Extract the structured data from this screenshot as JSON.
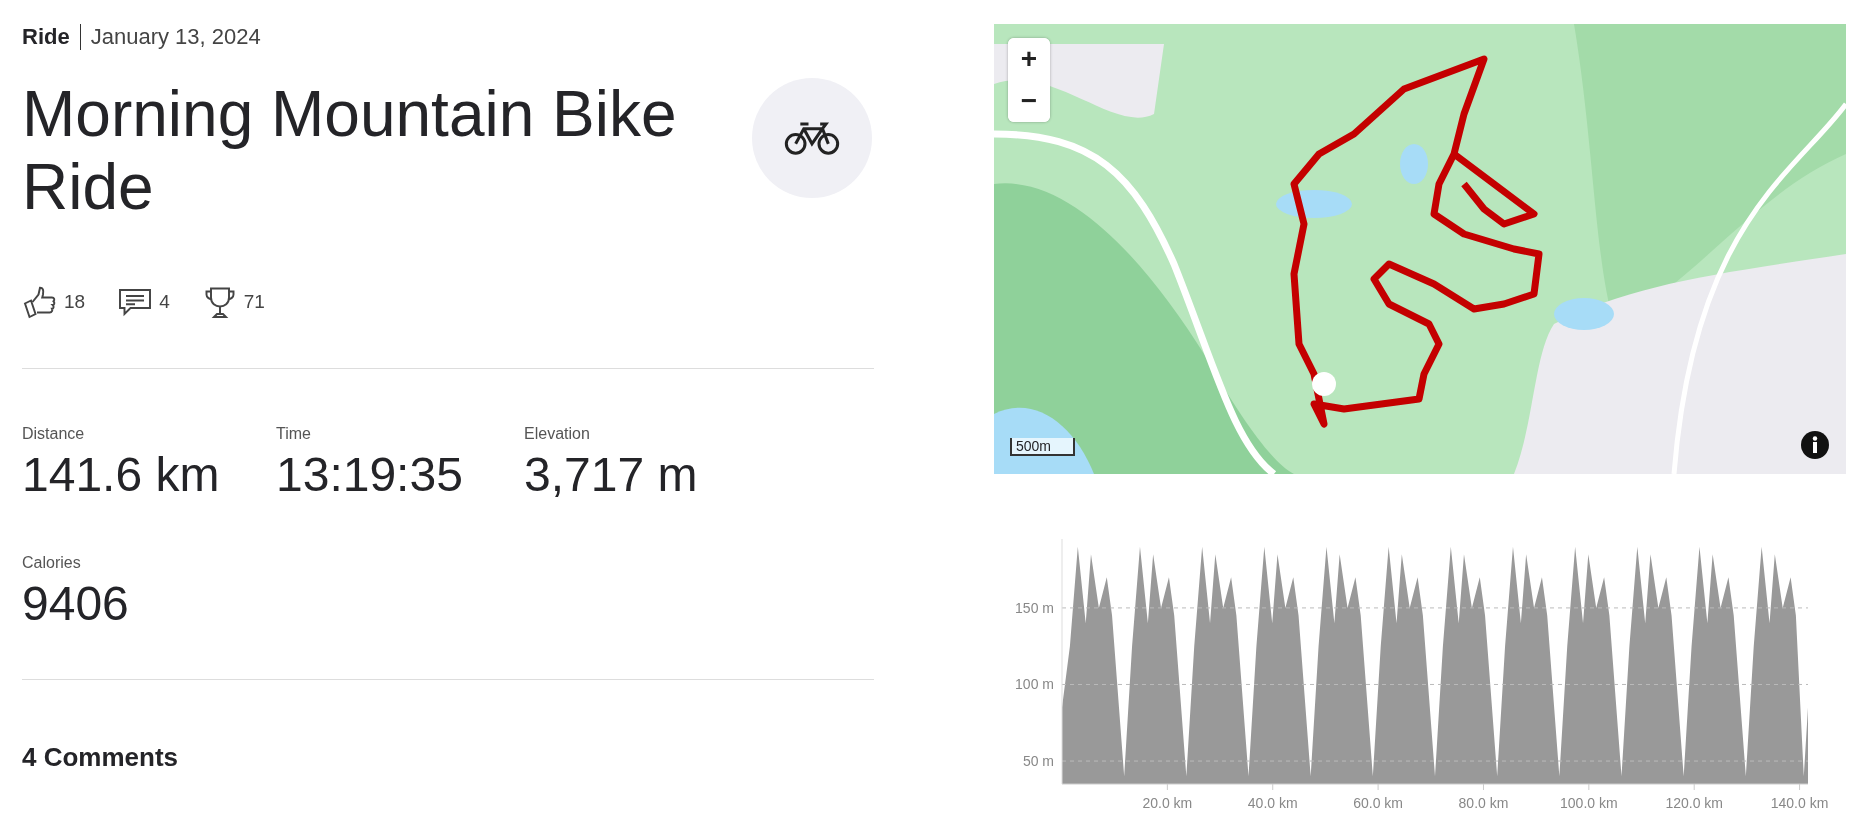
{
  "header": {
    "sport": "Ride",
    "date": "January 13, 2024"
  },
  "title": "Morning Mountain Bike Ride",
  "social": [
    {
      "kind": "kudos",
      "count": "18"
    },
    {
      "kind": "comments",
      "count": "4"
    },
    {
      "kind": "achievements",
      "count": "71"
    }
  ],
  "stats": [
    {
      "label": "Distance",
      "value": "141.6 km"
    },
    {
      "label": "Time",
      "value": "13:19:35"
    },
    {
      "label": "Elevation",
      "value": "3,717 m"
    },
    {
      "label": "Calories",
      "value": "9406"
    }
  ],
  "comments_heading": "4 Comments",
  "map": {
    "kind": "picture",
    "zoom_in": "+",
    "zoom_out": "−",
    "scale": "500m"
  },
  "elevation": {
    "chart_data": {
      "type": "area",
      "xlim": [
        0,
        141.6
      ],
      "ylim": [
        35,
        195
      ],
      "grid": true,
      "xticks": [
        {
          "value": 20,
          "label": "20.0 km"
        },
        {
          "value": 40,
          "label": "40.0 km"
        },
        {
          "value": 60,
          "label": "60.0 km"
        },
        {
          "value": 80,
          "label": "80.0 km"
        },
        {
          "value": 100,
          "label": "100.0 km"
        },
        {
          "value": 120,
          "label": "120.0 km"
        },
        {
          "value": 140,
          "label": "140.0 km"
        }
      ],
      "yticks": [
        {
          "value": 50,
          "label": "50 m"
        },
        {
          "value": 100,
          "label": "100 m"
        },
        {
          "value": 150,
          "label": "150 m"
        }
      ],
      "x": [
        0,
        1.5,
        3,
        4.5,
        5.5,
        7,
        8.5,
        9.5,
        11.8,
        13.3,
        14.8,
        16.3,
        17.3,
        18.8,
        20.3,
        21.3,
        23.6,
        25.1,
        26.6,
        28.1,
        29.1,
        30.6,
        32.1,
        33.1,
        35.4,
        36.9,
        38.4,
        39.9,
        40.9,
        42.4,
        43.9,
        44.9,
        47.2,
        48.7,
        50.2,
        51.7,
        52.7,
        54.2,
        55.7,
        56.7,
        59,
        60.5,
        62,
        63.5,
        64.5,
        66,
        67.5,
        68.5,
        70.8,
        72.3,
        73.8,
        75.3,
        76.3,
        77.8,
        79.3,
        80.3,
        82.6,
        84.1,
        85.6,
        87.1,
        88.1,
        89.6,
        91.1,
        92.1,
        94.4,
        95.9,
        97.4,
        98.9,
        99.9,
        101.4,
        102.9,
        103.9,
        106.2,
        107.7,
        109.2,
        110.7,
        111.7,
        113.2,
        114.7,
        115.7,
        118,
        119.5,
        121,
        122.5,
        123.5,
        125,
        126.5,
        127.5,
        129.8,
        131.3,
        132.8,
        134.3,
        135.3,
        136.8,
        138.3,
        139.3,
        140.8,
        141.6
      ],
      "series": [
        {
          "color": "#999999",
          "values": [
            85,
            125,
            190,
            140,
            185,
            150,
            170,
            145,
            40,
            125,
            190,
            140,
            185,
            150,
            170,
            145,
            40,
            125,
            190,
            140,
            185,
            150,
            170,
            145,
            40,
            125,
            190,
            140,
            185,
            150,
            170,
            145,
            40,
            125,
            190,
            140,
            185,
            150,
            170,
            145,
            40,
            125,
            190,
            140,
            185,
            150,
            170,
            145,
            40,
            125,
            190,
            140,
            185,
            150,
            170,
            145,
            40,
            125,
            190,
            140,
            185,
            150,
            170,
            145,
            40,
            125,
            190,
            140,
            185,
            150,
            170,
            145,
            40,
            125,
            190,
            140,
            185,
            150,
            170,
            145,
            40,
            125,
            190,
            140,
            185,
            150,
            170,
            145,
            40,
            125,
            190,
            140,
            185,
            150,
            170,
            145,
            40,
            85
          ]
        }
      ]
    }
  }
}
